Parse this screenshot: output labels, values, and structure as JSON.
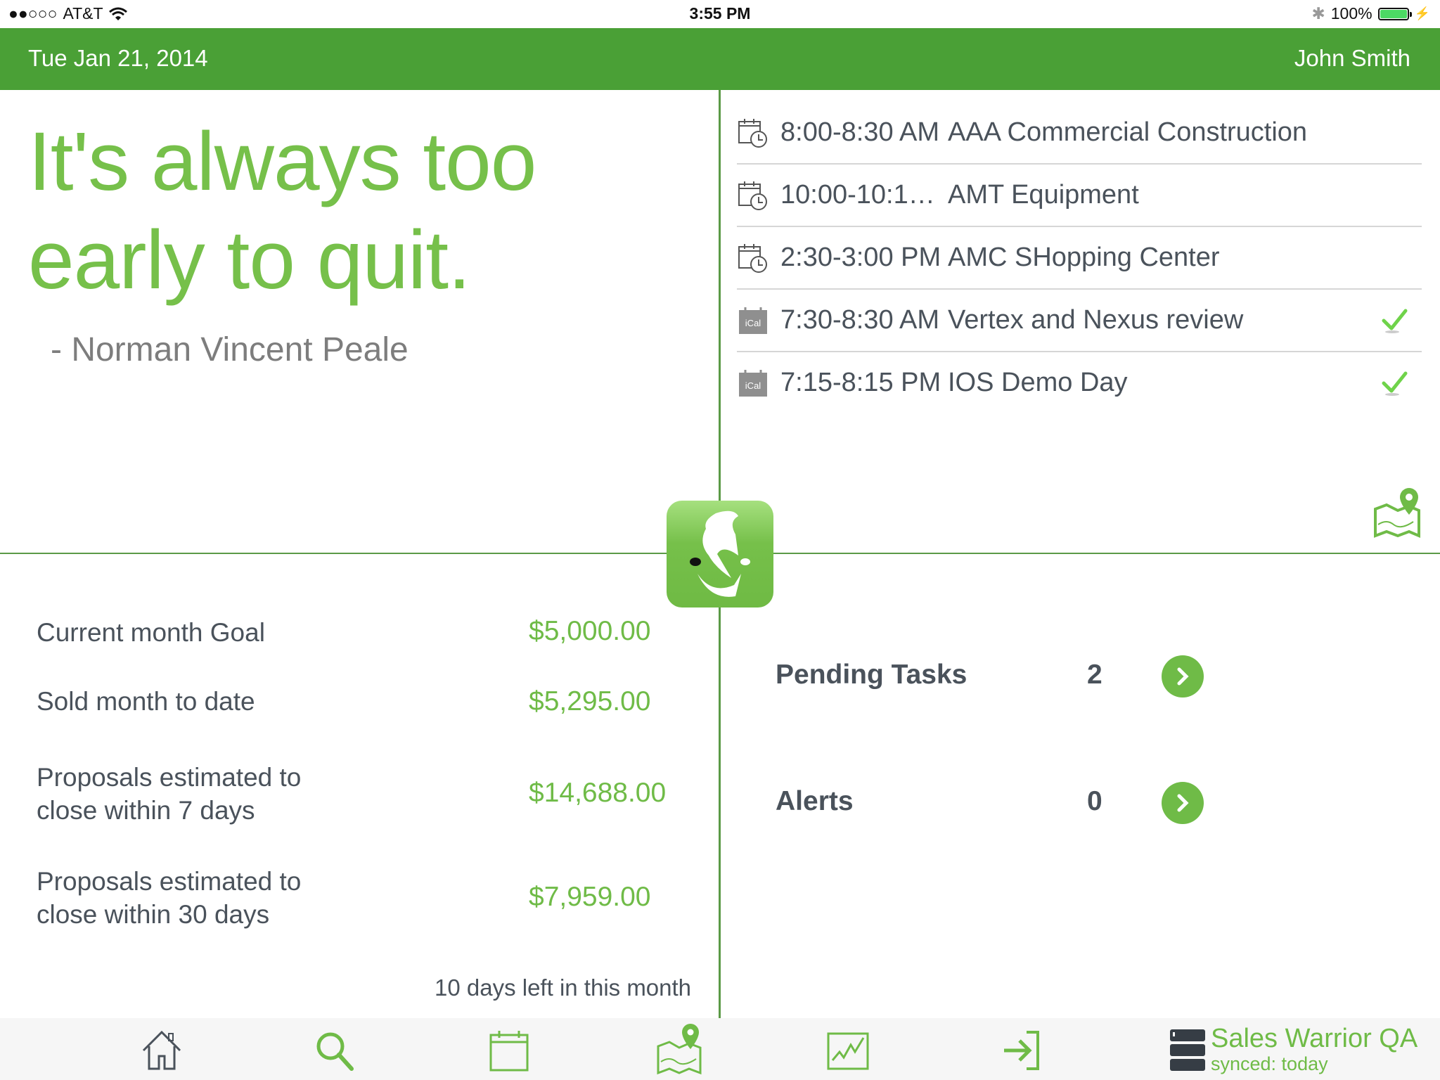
{
  "status_bar": {
    "carrier": "AT&T",
    "signal": "●●○○○",
    "time": "3:55 PM",
    "battery": "100%",
    "battery_level": 1.0
  },
  "header": {
    "date": "Tue Jan 21, 2014",
    "user": "John Smith"
  },
  "quote": {
    "line1": "It's always too",
    "line2": "early to quit.",
    "author": "- Norman Vincent Peale"
  },
  "appointments": [
    {
      "icon": "calendar-clock-icon",
      "time": "8:00-8:30 AM",
      "title": "AAA Commercial Construction",
      "completed": false
    },
    {
      "icon": "calendar-clock-icon",
      "time": "10:00-10:1…",
      "title": "AMT Equipment",
      "completed": false
    },
    {
      "icon": "calendar-clock-icon",
      "time": "2:30-3:00 PM",
      "title": "AMC SHopping Center",
      "completed": false
    },
    {
      "icon": "ical-icon",
      "time": "7:30-8:30 AM",
      "title": "Vertex and Nexus review",
      "completed": true
    },
    {
      "icon": "ical-icon",
      "time": "7:15-8:15 PM",
      "title": "IOS Demo Day",
      "completed": true
    }
  ],
  "ical_label": "iCal",
  "stats": [
    {
      "label": "Current month Goal",
      "value": "$5,000.00"
    },
    {
      "label": "Sold month to date",
      "value": "$5,295.00"
    },
    {
      "label": "Proposals estimated to close within 7 days",
      "value": "$14,688.00"
    },
    {
      "label": "Proposals estimated to close within 30 days",
      "value": "$7,959.00"
    }
  ],
  "stat_labels_wrapped": {
    "s2_line1": "Proposals estimated to",
    "s2_line2": "close within 7 days",
    "s3_line1": "Proposals estimated to",
    "s3_line2": "close within 30 days"
  },
  "days_left": "10 days left in this month",
  "tasks": {
    "pending_label": "Pending Tasks",
    "pending_count": "2",
    "alerts_label": "Alerts",
    "alerts_count": "0"
  },
  "toolbar": {
    "items": [
      "home-icon",
      "search-icon",
      "calendar-icon",
      "map-icon",
      "chart-icon",
      "sign-in-icon"
    ],
    "sync_title": "Sales Warrior QA",
    "sync_status": "synced: today"
  },
  "colors": {
    "brand_green": "#4aa036",
    "accent_green": "#76c04a",
    "text_dark": "#4a525b"
  }
}
